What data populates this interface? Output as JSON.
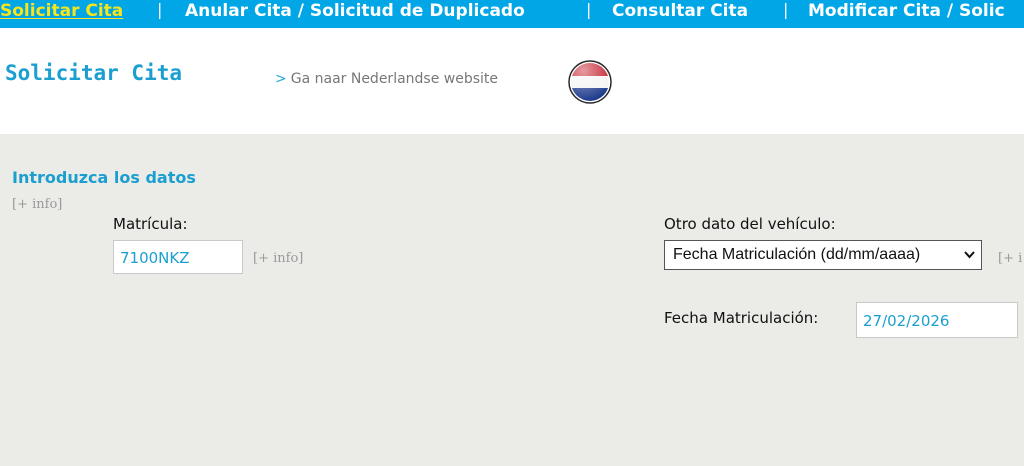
{
  "nav": {
    "tabs": [
      {
        "label": "Solicitar Cita",
        "active": true
      },
      {
        "label": "Anular Cita / Solicitud de Duplicado",
        "active": false
      },
      {
        "label": "Consultar Cita",
        "active": false
      },
      {
        "label": "Modificar Cita / Solic",
        "active": false
      }
    ],
    "separator": "|"
  },
  "header": {
    "title": "Solicitar Cita",
    "nl_link_arrow": ">",
    "nl_link": "Ga naar Nederlandse website",
    "flag_icon": "netherlands-flag-icon"
  },
  "form": {
    "section_title": "Introduzca los datos",
    "section_info": "[+ info]",
    "matricula": {
      "label": "Matrícula:",
      "value": "7100NKZ",
      "info": "[+ info]"
    },
    "otro_dato": {
      "label": "Otro dato del vehículo:",
      "selected": "Fecha Matriculación (dd/mm/aaaa)",
      "info": "[+ i"
    },
    "fecha": {
      "label": "Fecha Matriculación:",
      "value": "27/02/2026"
    }
  },
  "colors": {
    "nav_bg": "#00a6e6",
    "active_tab": "#f6e51c",
    "accent": "#1a9fd0",
    "content_bg": "#ebebe7"
  }
}
